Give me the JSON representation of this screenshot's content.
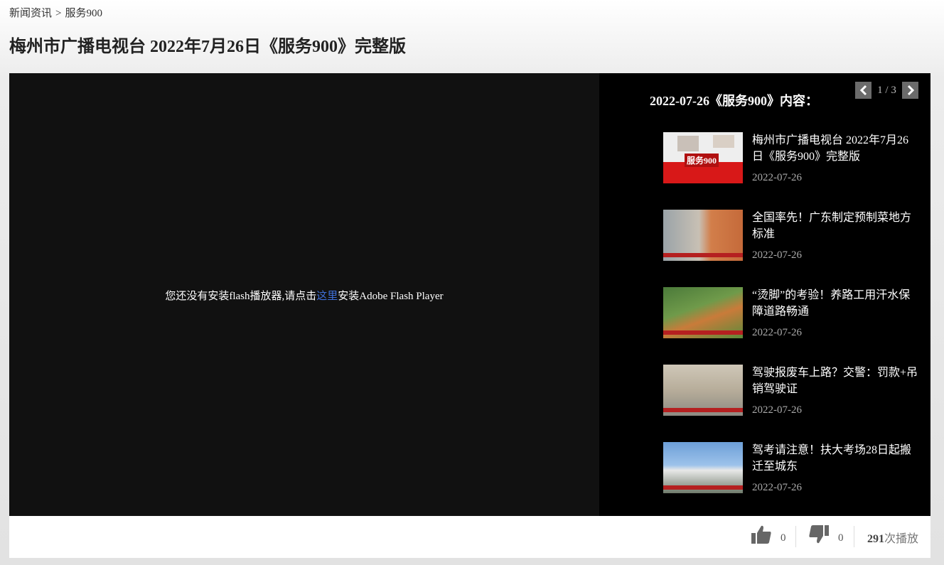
{
  "breadcrumb": {
    "root": "新闻资讯",
    "separator": ">",
    "current": "服务900"
  },
  "page_title": "梅州市广播电视台 2022年7月26日《服务900》完整版",
  "player": {
    "msg_before": "您还没有安装flash播放器,请点击",
    "msg_link": "这里",
    "msg_after": "安装Adobe Flash Player"
  },
  "sidebar": {
    "title": "2022-07-26《服务900》内容：",
    "pager": {
      "text": "1 / 3"
    },
    "items": [
      {
        "title": "梅州市广播电视台 2022年7月26日《服务900》完整版",
        "date": "2022-07-26",
        "thumb_label": "服务900"
      },
      {
        "title": "全国率先！广东制定预制菜地方标准",
        "date": "2022-07-26"
      },
      {
        "title": "“烫脚”的考验！养路工用汗水保障道路畅通",
        "date": "2022-07-26"
      },
      {
        "title": "驾驶报废车上路？交警：罚款+吊销驾驶证",
        "date": "2022-07-26"
      },
      {
        "title": "驾考请注意！扶大考场28日起搬迁至城东",
        "date": "2022-07-26"
      }
    ]
  },
  "stats": {
    "likes": "0",
    "dislikes": "0",
    "play_count": "291",
    "play_suffix": "次播放"
  },
  "colors": {
    "link": "#3f6fd8",
    "player_bg": "#111111",
    "sidebar_bg": "#000000"
  }
}
